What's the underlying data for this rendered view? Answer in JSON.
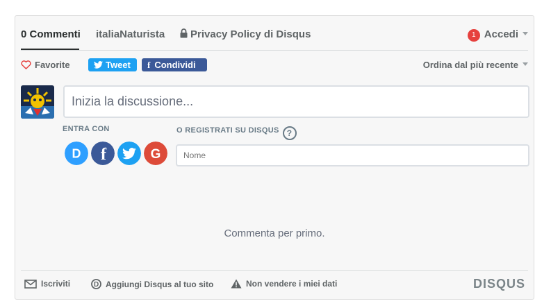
{
  "nav": {
    "tabs": [
      {
        "label": "0 Commenti"
      },
      {
        "label": "italiaNaturista"
      },
      {
        "label": "Privacy Policy di Disqus"
      }
    ],
    "notification_count": "1",
    "login_label": "Accedi"
  },
  "toolbar": {
    "favorite_label": "Favorite",
    "tweet_label": "Tweet",
    "share_label": "Condividi",
    "sort_label": "Ordina dal più recente"
  },
  "composer": {
    "placeholder": "Inizia la discussione..."
  },
  "login_section": {
    "entra_label": "ENTRA CON",
    "register_label": "O REGISTRATI SU DISQUS",
    "help_label": "?",
    "name_placeholder": "Nome",
    "providers": [
      "disqus-icon",
      "facebook-icon",
      "twitter-icon",
      "google-icon"
    ]
  },
  "empty_message": "Commenta per primo.",
  "footer": {
    "subscribe_label": "Iscriviti",
    "add_disqus_label": "Aggiungi Disqus al tuo sito",
    "do_not_sell_label": "Non vendere i miei dati",
    "logo_text": "DISQUS"
  },
  "colors": {
    "twitter": "#1da1f2",
    "facebook": "#3b5998",
    "disqus": "#2e9fff",
    "google": "#dd4b39",
    "badge": "#e6413e"
  }
}
